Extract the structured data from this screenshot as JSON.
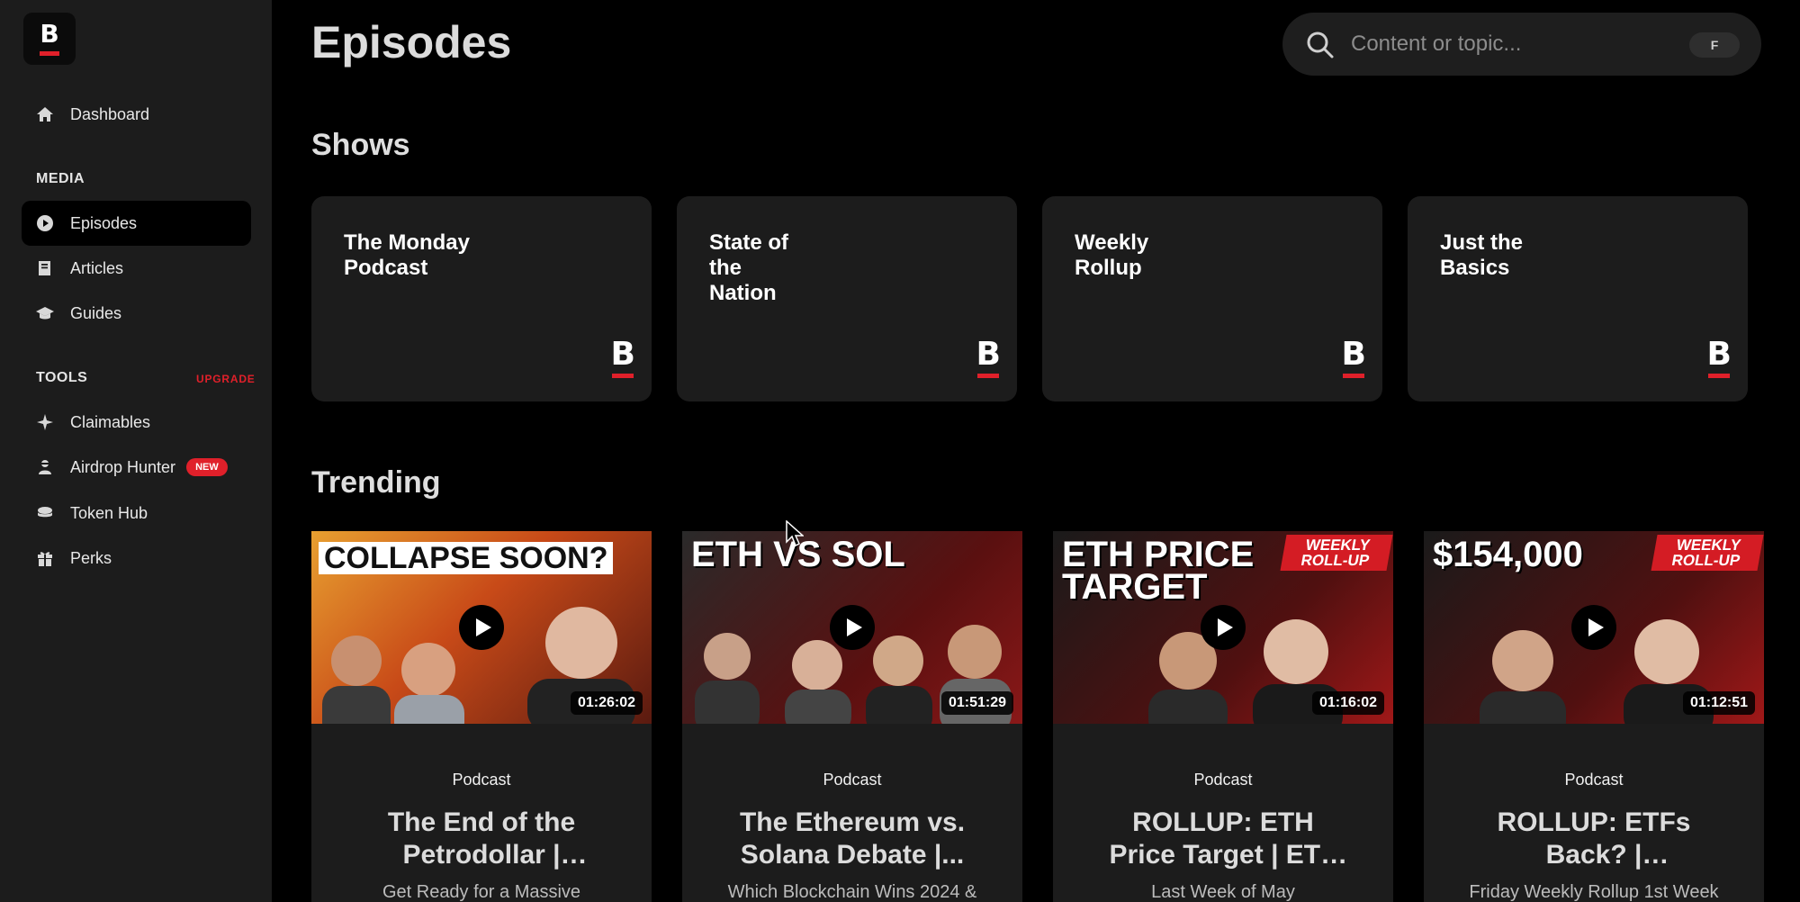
{
  "brand": {
    "logo_letter": "B",
    "accent": "#e0202a"
  },
  "sidebar": {
    "dashboard": "Dashboard",
    "media_heading": "MEDIA",
    "media_items": [
      {
        "label": "Episodes",
        "icon": "play-circle-icon",
        "active": true
      },
      {
        "label": "Articles",
        "icon": "book-icon"
      },
      {
        "label": "Guides",
        "icon": "graduation-cap-icon"
      }
    ],
    "tools_heading": "TOOLS",
    "upgrade": "UPGRADE",
    "tools_items": [
      {
        "label": "Claimables",
        "icon": "sparkle-icon"
      },
      {
        "label": "Airdrop Hunter",
        "icon": "hunter-icon",
        "badge": "NEW"
      },
      {
        "label": "Token Hub",
        "icon": "coins-icon"
      },
      {
        "label": "Perks",
        "icon": "gift-icon"
      }
    ]
  },
  "header": {
    "title": "Episodes",
    "search_placeholder": "Content or topic...",
    "search_shortcut": "F"
  },
  "shows": {
    "heading": "Shows",
    "items": [
      {
        "name": "The Monday Podcast"
      },
      {
        "name": "State of the Nation"
      },
      {
        "name": "Weekly Rollup"
      },
      {
        "name": "Just the Basics"
      }
    ],
    "mark": "B"
  },
  "trending": {
    "heading": "Trending",
    "items": [
      {
        "thumb_text": "COLLAPSE SOON?",
        "duration": "01:26:02",
        "category": "Podcast",
        "title": "The End of the Petrodollar | Luke...",
        "description": "Get Ready for a Massive"
      },
      {
        "thumb_text": "ETH VS SOL",
        "duration": "01:51:29",
        "category": "Podcast",
        "title": "The Ethereum vs. Solana Debate |...",
        "description": "Which Blockchain Wins 2024 &"
      },
      {
        "thumb_text": "ETH PRICE TARGET",
        "weekly_tag": "WEEKLY ROLL-UP",
        "duration": "01:16:02",
        "category": "Podcast",
        "title": "ROLLUP: ETH Price Target | ETF Launc...",
        "description": "Last Week of May"
      },
      {
        "thumb_text": "$154,000",
        "weekly_tag": "WEEKLY ROLL-UP",
        "duration": "01:12:51",
        "category": "Podcast",
        "title": "ROLLUP: ETFs Back? | Robinhood...",
        "description": "Friday Weekly Rollup 1st Week"
      }
    ]
  }
}
